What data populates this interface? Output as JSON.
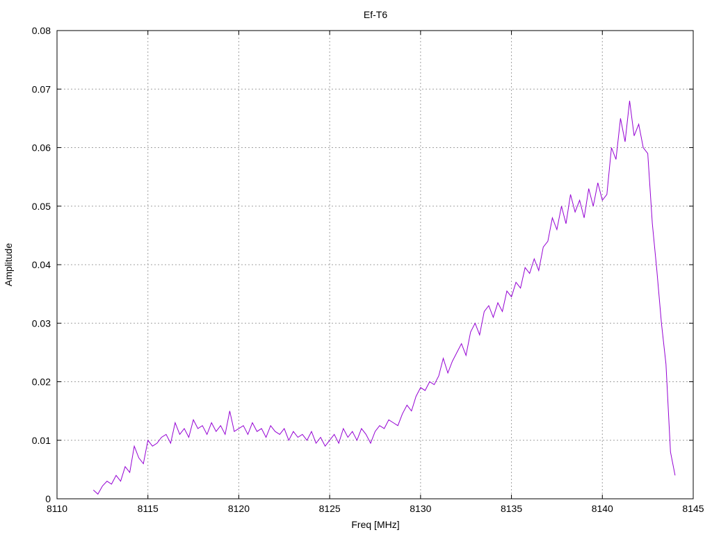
{
  "chart_data": {
    "type": "line",
    "title": "Ef-T6",
    "xlabel": "Freq [MHz]",
    "ylabel": "Amplitude",
    "xlim": [
      8110,
      8145
    ],
    "ylim": [
      0,
      0.08
    ],
    "grid": true,
    "xticks": [
      "8110",
      "8115",
      "8120",
      "8125",
      "8130",
      "8135",
      "8140",
      "8145"
    ],
    "yticks": [
      "0",
      "0.01",
      "0.02",
      "0.03",
      "0.04",
      "0.05",
      "0.06",
      "0.07",
      "0.08"
    ],
    "series": [
      {
        "name": "Ef-T6",
        "color": "#9400d3",
        "x_start": 8112,
        "x_step": 0.25,
        "values": [
          0.0015,
          0.0008,
          0.0022,
          0.003,
          0.0025,
          0.004,
          0.003,
          0.0055,
          0.0045,
          0.009,
          0.007,
          0.006,
          0.01,
          0.009,
          0.0095,
          0.0105,
          0.011,
          0.0095,
          0.013,
          0.011,
          0.012,
          0.0105,
          0.0135,
          0.012,
          0.0125,
          0.011,
          0.013,
          0.0115,
          0.0125,
          0.011,
          0.015,
          0.0115,
          0.012,
          0.0125,
          0.011,
          0.013,
          0.0115,
          0.012,
          0.0105,
          0.0125,
          0.0115,
          0.011,
          0.012,
          0.01,
          0.0115,
          0.0105,
          0.011,
          0.01,
          0.0115,
          0.0095,
          0.0105,
          0.009,
          0.01,
          0.011,
          0.0095,
          0.012,
          0.0105,
          0.0115,
          0.01,
          0.012,
          0.011,
          0.0095,
          0.0115,
          0.0125,
          0.012,
          0.0135,
          0.013,
          0.0125,
          0.0145,
          0.016,
          0.015,
          0.0175,
          0.019,
          0.0185,
          0.02,
          0.0195,
          0.021,
          0.024,
          0.0215,
          0.0235,
          0.025,
          0.0265,
          0.0245,
          0.0285,
          0.03,
          0.028,
          0.032,
          0.033,
          0.031,
          0.0335,
          0.032,
          0.0355,
          0.0345,
          0.037,
          0.036,
          0.0395,
          0.0385,
          0.041,
          0.039,
          0.043,
          0.044,
          0.048,
          0.046,
          0.05,
          0.047,
          0.052,
          0.049,
          0.051,
          0.048,
          0.053,
          0.05,
          0.054,
          0.051,
          0.052,
          0.06,
          0.058,
          0.065,
          0.061,
          0.068,
          0.062,
          0.064,
          0.06,
          0.059,
          0.047,
          0.039,
          0.03,
          0.023,
          0.008,
          0.004
        ]
      }
    ]
  }
}
